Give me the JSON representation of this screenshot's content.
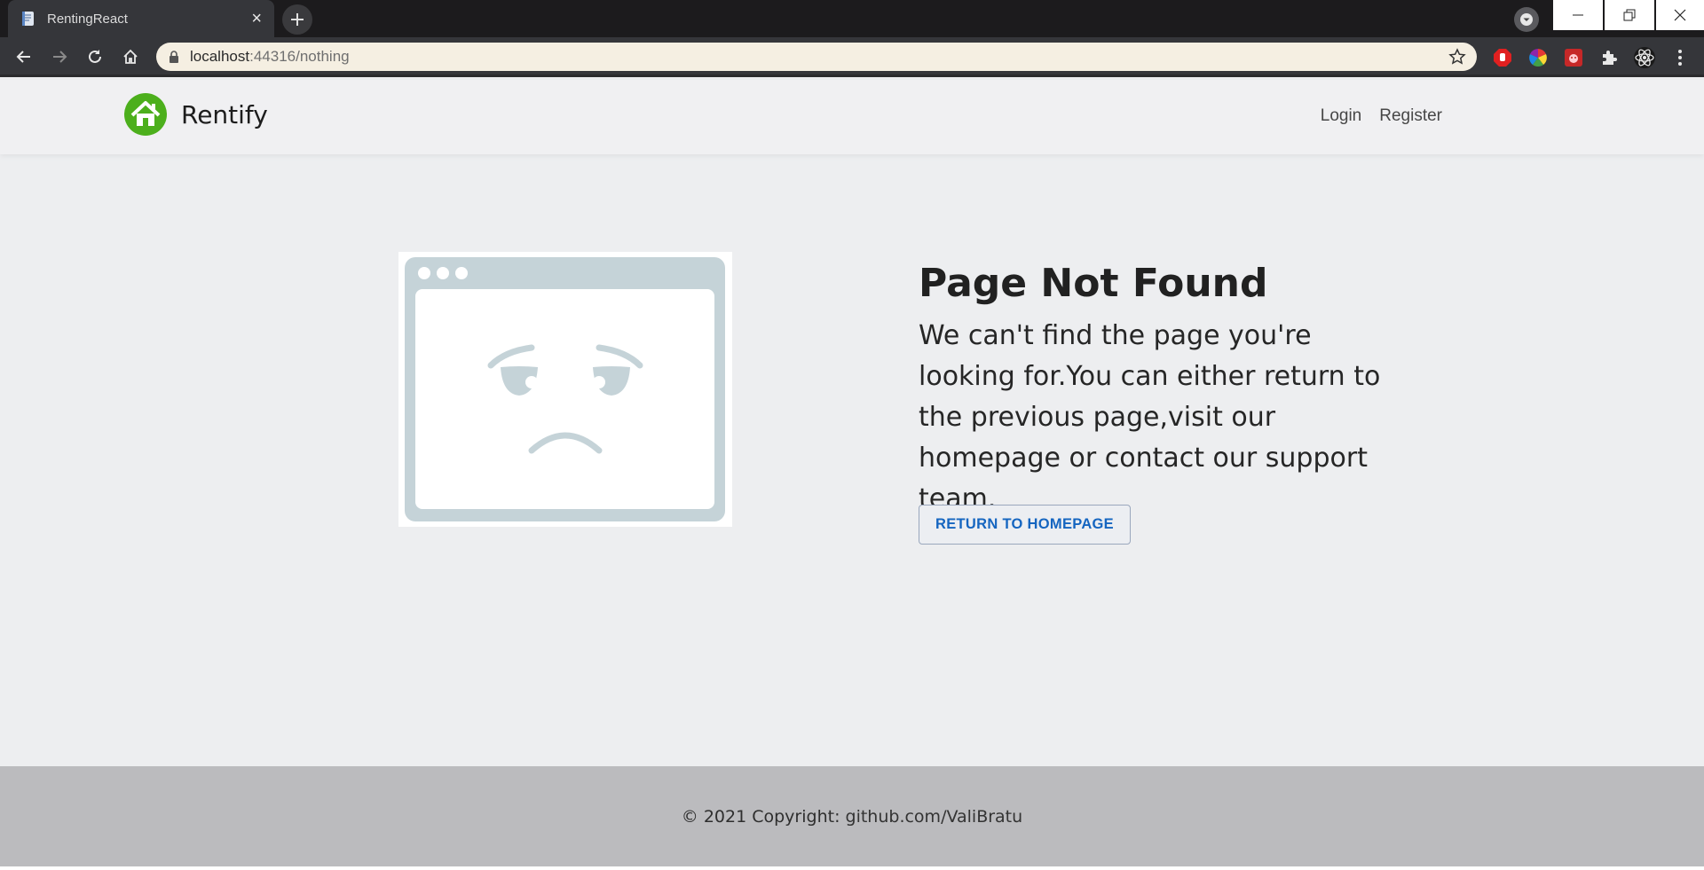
{
  "browser": {
    "tab_title": "RentingReact",
    "tab_close": "×",
    "url_host": "localhost",
    "url_path": ":44316/nothing"
  },
  "site": {
    "brand_name": "Rentify",
    "brand_color": "#4caf1c",
    "nav": [
      {
        "label": "Login"
      },
      {
        "label": "Register"
      }
    ]
  },
  "main": {
    "title": "Page Not Found",
    "message": "We can't find the page you're looking for.You can either return to the previous page,visit our homepage or contact our support team.",
    "button_label": "RETURN TO HOMEPAGE",
    "accent_color": "#1565c0"
  },
  "footer": {
    "prefix": "© 2021 Copyright: ",
    "link": "github.com/ValiBratu"
  }
}
